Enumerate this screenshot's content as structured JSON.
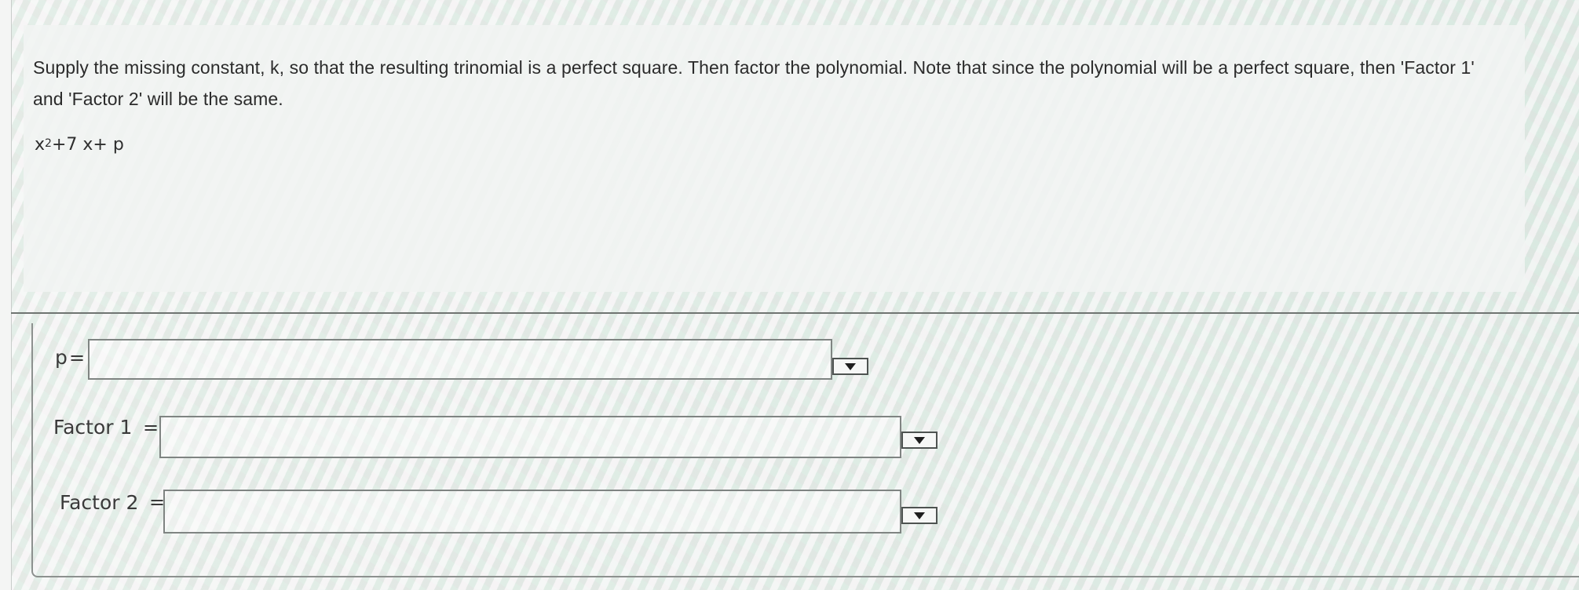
{
  "question": {
    "instructions": "Supply the missing constant, k, so that the resulting trinomial is a perfect square. Then factor the polynomial. Note that since the polynomial will be a perfect square, then 'Factor 1' and 'Factor 2' will be the same.",
    "expression_base": "x",
    "expression_exponent": "2",
    "expression_rest": "+7 x+ p"
  },
  "answers": {
    "p": {
      "label": "p",
      "equals": "=",
      "value": ""
    },
    "factor1": {
      "label": "Factor 1",
      "equals": "=",
      "value": ""
    },
    "factor2": {
      "label": "Factor 2",
      "equals": "=",
      "value": ""
    }
  },
  "icons": {
    "dropdown": "chevron-down-icon"
  }
}
